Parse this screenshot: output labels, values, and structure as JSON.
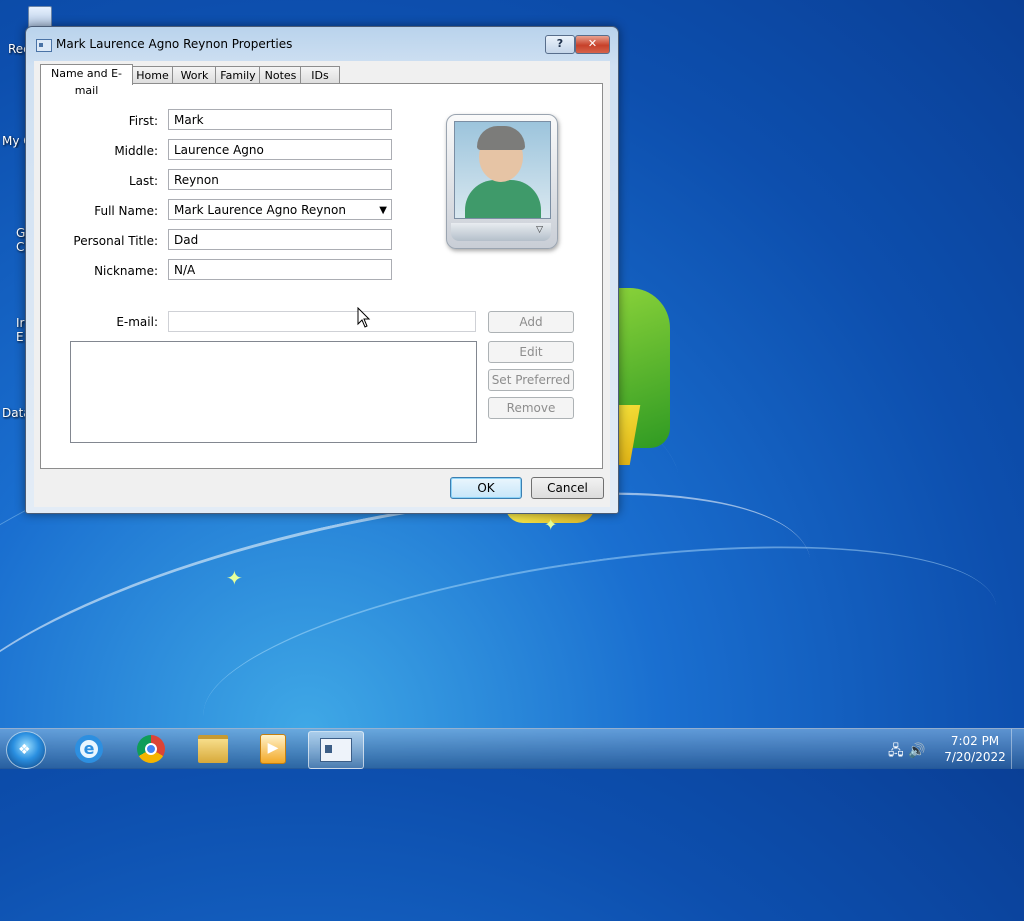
{
  "desktop": {
    "icons": [
      {
        "label": "Rec"
      },
      {
        "label": "My C"
      },
      {
        "label": "G C"
      },
      {
        "label": "Ir E"
      },
      {
        "label": "Data"
      }
    ]
  },
  "window": {
    "title": "Mark Laurence Agno Reynon Properties",
    "help_glyph": "?",
    "close_glyph": "✕",
    "tabs": [
      {
        "label": "Name and E-mail",
        "active": true
      },
      {
        "label": "Home"
      },
      {
        "label": "Work"
      },
      {
        "label": "Family"
      },
      {
        "label": "Notes"
      },
      {
        "label": "IDs"
      }
    ],
    "form": {
      "first": {
        "label": "First:",
        "value": "Mark"
      },
      "middle": {
        "label": "Middle:",
        "value": "Laurence Agno"
      },
      "last": {
        "label": "Last:",
        "value": "Reynon"
      },
      "full_name": {
        "label": "Full Name:",
        "value": "Mark Laurence Agno Reynon"
      },
      "personal_title": {
        "label": "Personal Title:",
        "value": "Dad"
      },
      "nickname": {
        "label": "Nickname:",
        "value": "N/A"
      },
      "email": {
        "label": "E-mail:",
        "value": ""
      }
    },
    "email_buttons": {
      "add": "Add",
      "edit": "Edit",
      "set_preferred": "Set Preferred",
      "remove": "Remove"
    },
    "ok": "OK",
    "cancel": "Cancel"
  },
  "taskbar": {
    "time": "7:02 PM",
    "date": "7/20/2022"
  },
  "colors": {
    "desktop_blue": "#1a6fd0",
    "default_button_border": "#3c7fb1",
    "close_red": "#c7412a"
  }
}
